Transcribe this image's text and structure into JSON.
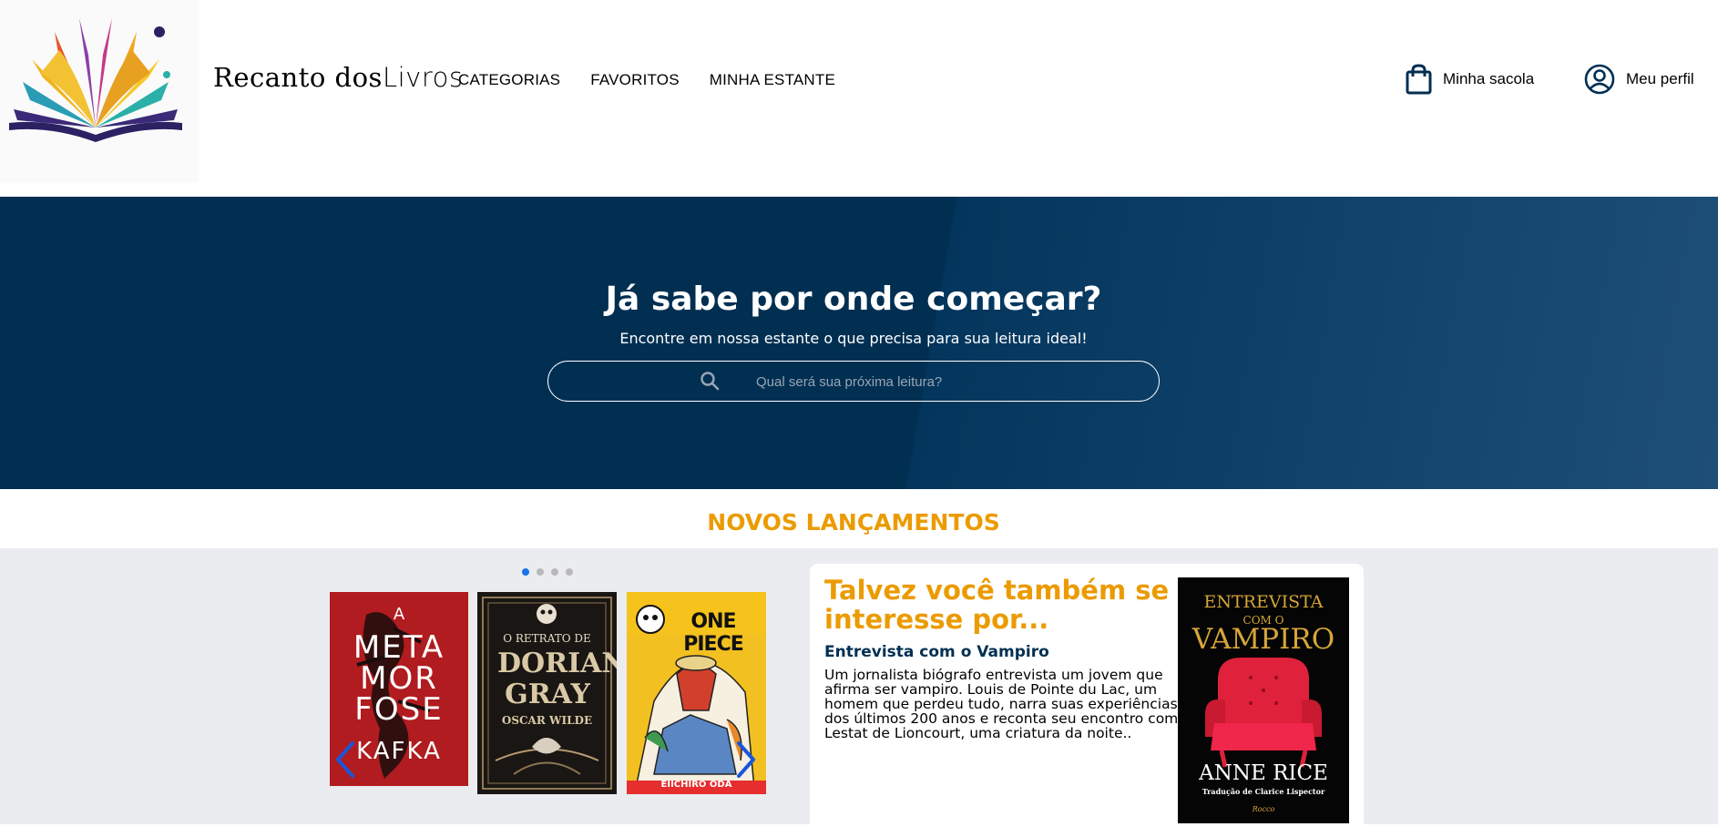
{
  "header": {
    "brand_part1": "Recanto dos",
    "brand_part2": "Livros",
    "nav": [
      "CATEGORIAS",
      "FAVORITOS",
      "MINHA ESTANTE"
    ],
    "bag_label": "Minha sacola",
    "profile_label": "Meu perfil"
  },
  "hero": {
    "title": "Já sabe por onde começar?",
    "subtitle": "Encontre em nossa estante o que precisa para sua leitura ideal!",
    "search_placeholder": "Qual será sua próxima leitura?"
  },
  "releases": {
    "title": "NOVOS LANÇAMENTOS",
    "dots": 4,
    "active_dot": 0,
    "books": [
      {
        "cover_text_top": "A",
        "cover_text_main": "META MOR FOSE",
        "cover_author": "KAFKA"
      },
      {
        "cover_text_top": "O RETRATO DE",
        "cover_text_main": "DORIAN GRAY",
        "cover_author": "OSCAR WILDE"
      },
      {
        "cover_text_top": "ONE PIECE",
        "cover_text_main": "ONE PIECE",
        "cover_author": "EIICHIRO ODA"
      }
    ]
  },
  "suggestion": {
    "title": "Talvez você também se interesse por...",
    "book_title": "Entrevista com o Vampiro",
    "description": "Um jornalista biógrafo entrevista um jovem que afirma ser vampiro. Louis de Pointe du Lac, um homem que perdeu tudo, narra suas experiências dos últimos 200 anos e reconta seu encontro com Lestat de Lioncourt, uma criatura da noite..",
    "cover": {
      "line1": "ENTREVISTA",
      "line2": "COM O",
      "line3": "VAMPIRO",
      "author": "ANNE RICE",
      "translator": "Tradução de Clarice Lispector",
      "publisher": "Rocco"
    }
  },
  "colors": {
    "accent": "#eb9b00",
    "navy": "#002f52",
    "dot_active": "#1a73e8"
  }
}
